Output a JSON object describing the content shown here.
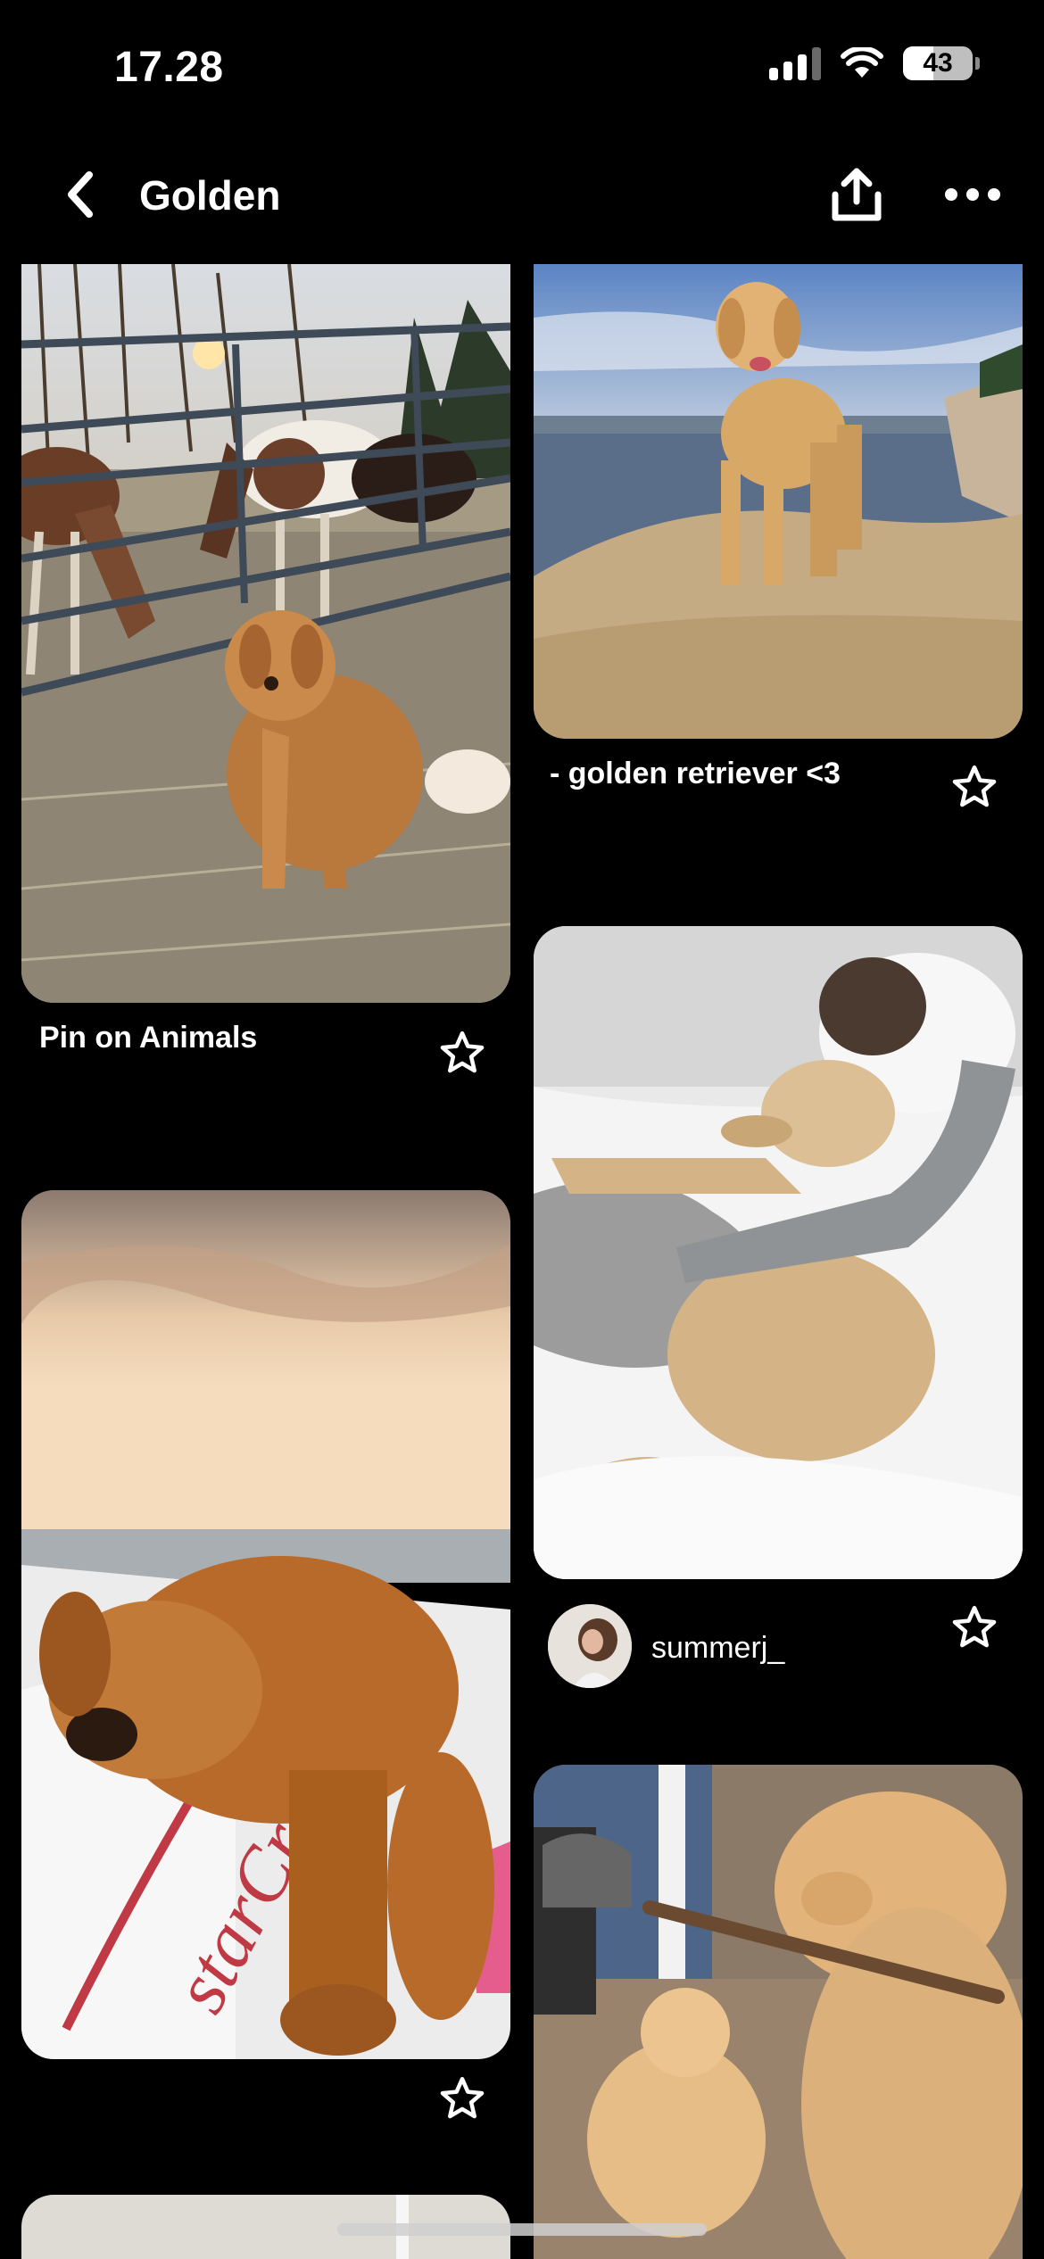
{
  "status_bar": {
    "time": "17.28",
    "battery": "43",
    "battery_level": 0.43,
    "icons": [
      "cellular-signal-icon",
      "wifi-icon",
      "battery-icon"
    ]
  },
  "header": {
    "title": "Golden",
    "icons": [
      "back-chevron-icon",
      "share-icon",
      "more-icon"
    ]
  },
  "pins": [
    {
      "title": "Pin on Animals",
      "icon": "star-icon",
      "image": "golden retriever sitting by horses at a fence at sunset"
    },
    {
      "title": "- golden retriever <3",
      "icon": "star-icon",
      "image": "golden retriever standing on a rock by the sea"
    },
    {
      "title": "",
      "icon": "star-icon",
      "image": "golden retriever resting head on a Starcraft boat"
    },
    {
      "user": {
        "name": "summerj_",
        "avatar_icon": "user-avatar"
      },
      "icon": "star-icon",
      "image": "person hugging golden retriever in white bed"
    },
    {
      "image": "golden retriever and puppy with a stick"
    }
  ],
  "colors": {
    "background": "#000000",
    "text": "#ffffff"
  }
}
